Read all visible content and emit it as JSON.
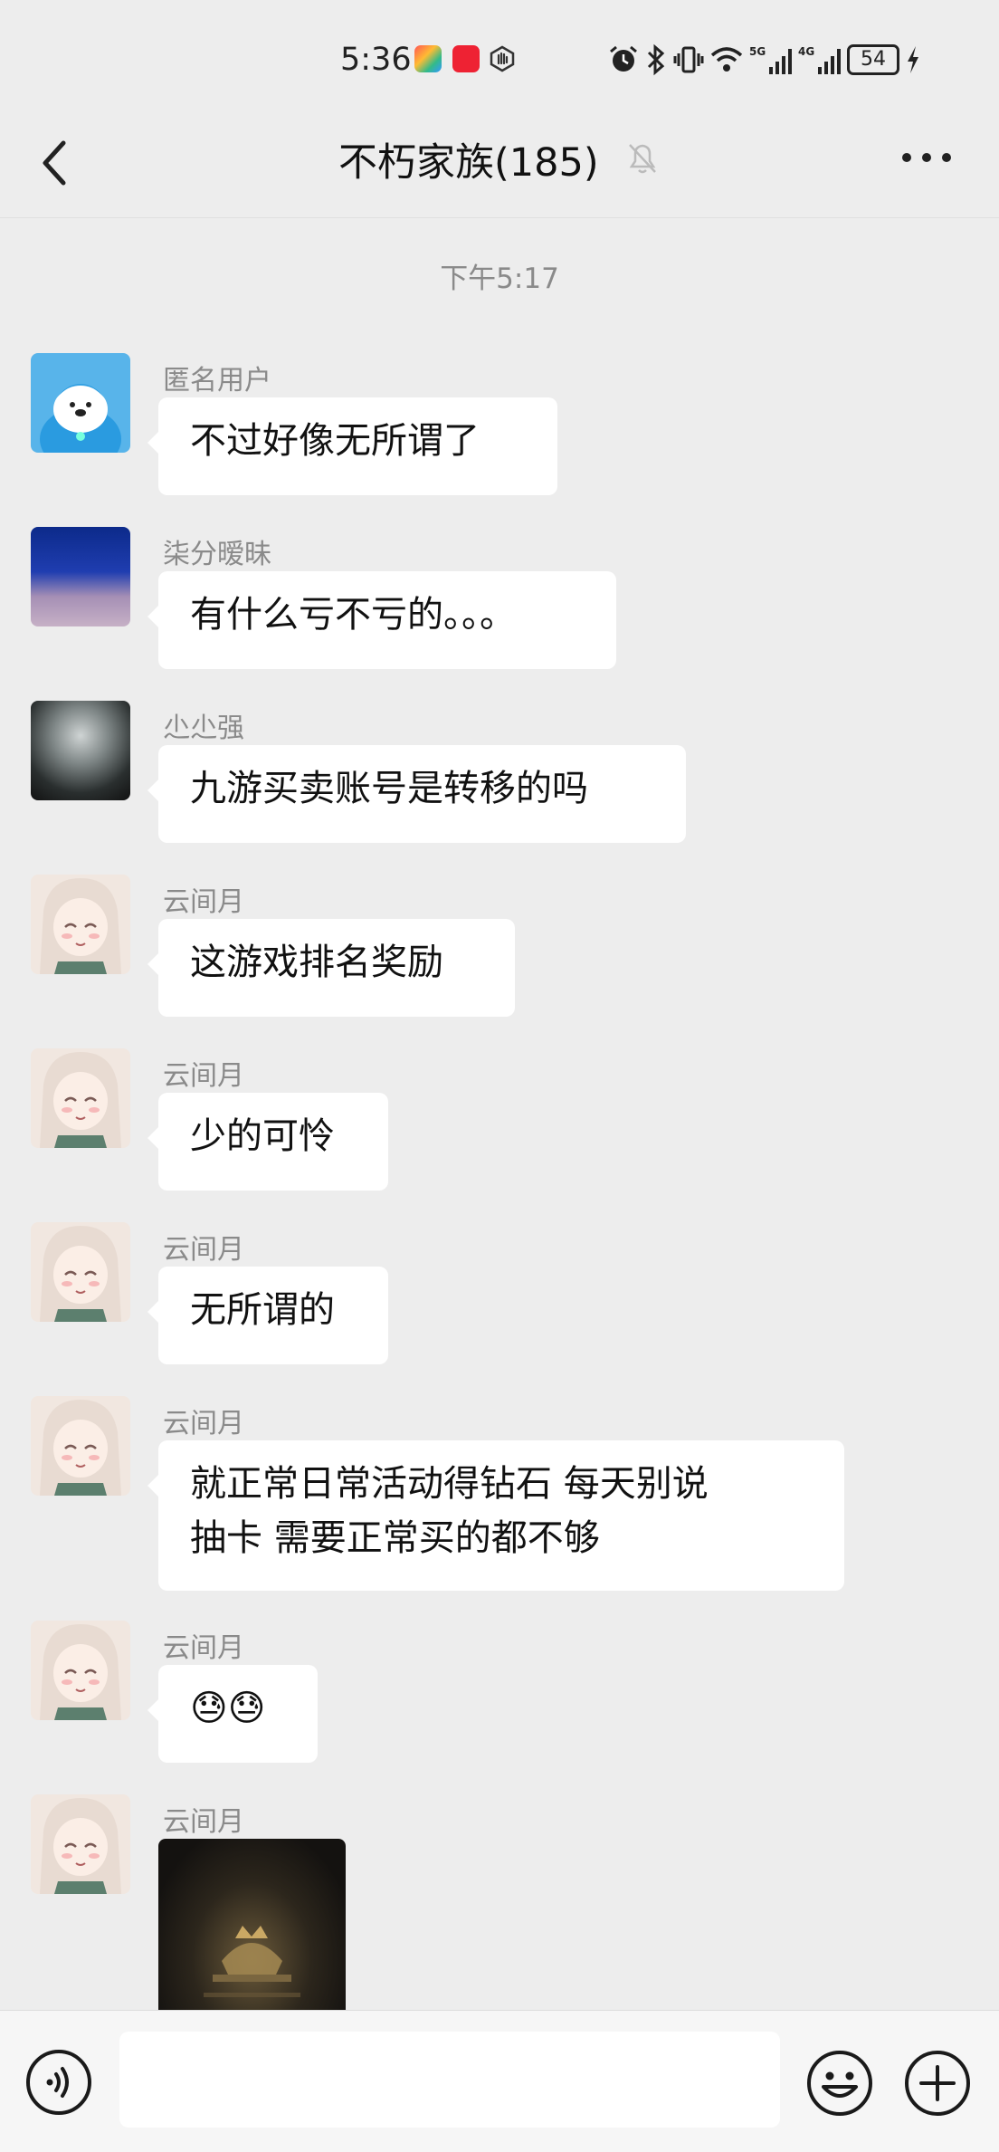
{
  "status_bar": {
    "time": "5:36",
    "battery": "54"
  },
  "header": {
    "title": "不朽家族(185)"
  },
  "timestamp": "下午5:17",
  "messages": [
    {
      "sender": "匿名用户",
      "text": "不过好像无所谓了"
    },
    {
      "sender": "柒分暧昧",
      "text": "有什么亏不亏的。。。"
    },
    {
      "sender": "尐尐强",
      "text": "九游买卖账号是转移的吗"
    },
    {
      "sender": "云间月",
      "text": "这游戏排名奖励"
    },
    {
      "sender": "云间月",
      "text": "少的可怜"
    },
    {
      "sender": "云间月",
      "text": "无所谓的"
    },
    {
      "sender": "云间月",
      "text": "就正常日常活动得钻石 每天别说\n抽卡 需要正常买的都不够"
    },
    {
      "sender": "云间月",
      "text": "😓😓"
    },
    {
      "sender": "云间月",
      "text": ""
    }
  ],
  "input": {
    "value": ""
  }
}
